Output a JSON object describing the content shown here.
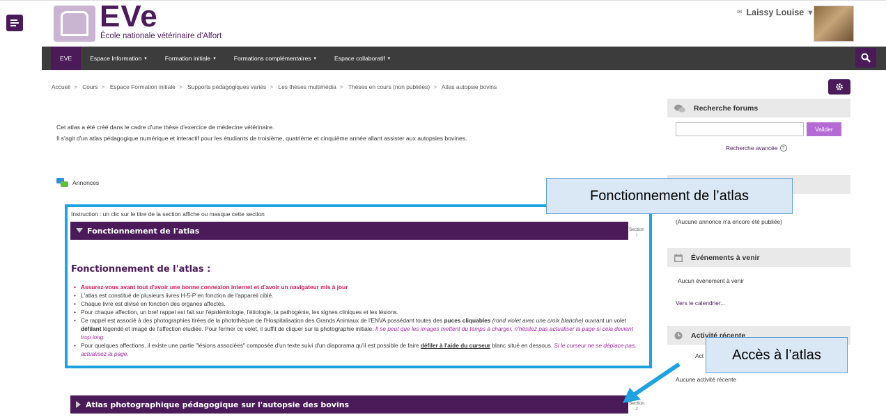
{
  "header": {
    "logo_text": "EVe",
    "logo_subtitle": "École nationale vétérinaire d'Alfort",
    "user_name": "Laissy Louise",
    "user_caret": "▾"
  },
  "navbar": {
    "items": [
      {
        "label": "EVE",
        "caret": ""
      },
      {
        "label": "Espace Information",
        "caret": "▾"
      },
      {
        "label": "Formation initiale",
        "caret": "▾"
      },
      {
        "label": "Formations complémentaires",
        "caret": "▾"
      },
      {
        "label": "Espace collaboratif",
        "caret": "▾"
      }
    ]
  },
  "breadcrumb": {
    "items": [
      "Accueil",
      "Cours",
      "Espace Formation initiale",
      "Supports pédagogiques variés",
      "Les thèses multimédia",
      "Thèses en cours (non publiées)",
      "Atlas autopsie bovins"
    ],
    "separator": ">"
  },
  "intro": {
    "line1": "Cet atlas a été créé dans le cadre d'une thèse d'exercice de médecine vétérinaire.",
    "line2": "Il s'agit d'un atlas pédagogique numérique et interactif pour les étudiants de troisième, quatrième et cinquième année allant assister aux autopsies bovines."
  },
  "annonces_label": "Annonces",
  "instruction": "Instruction : un clic sur le titre de la section affiche ou masque cette section",
  "section1": {
    "title": "Fonctionnement de l'atlas",
    "label": "Section",
    "number": "1",
    "heading": "Fonctionnement de l'atlas :",
    "bullets": {
      "b1": "Assurez-vous avant tout d'avoir une bonne connexion internet et d'avoir un navigateur mis à jour",
      "b2": "L'atlas est constitué de plusieurs livres H-5-P en fonction de l'appareil ciblé.",
      "b3": "Chaque livre est divisé en fonction des organes affectés.",
      "b4": "Pour chaque affection, un bref rappel est fait sur l'épidémiologie, l'étiologie, la pathogénie, les signes cliniques et les lésions.",
      "b5_a": "Ce rappel est associé à des photographies tirées de la photothèque de l'Hospitalisation des Grands Animaux de l'ENVA possédant toutes des ",
      "b5_b": "puces cliquables",
      "b5_c": " (rond violet avec une croix blanche)",
      "b5_d": " ouvrant un volet ",
      "b5_e": "défilant",
      "b5_f": " légendé et imagé de l'affection étudiée. Pour fermer ce volet, il suffit de cliquer sur la photographie initiale. ",
      "b5_g": "Il se peut que les images mettent du temps à charger, n'hésitez pas actualiser la page si cela devient trop long.",
      "b6_a": "Pour quelques affections, il existe une partie \"lésions associées\" composée d'un texte suivi d'un diaporama qu'il est possible de faire ",
      "b6_b": "défiler à l'aide du curseur",
      "b6_c": " blanc situé en dessous. ",
      "b6_d": "Si le curseur ne se déplace pas, actualisez la page."
    }
  },
  "section2": {
    "title": "Atlas photographique pédagogique sur l'autopsie des bovins",
    "label": "Section",
    "number": "2"
  },
  "sidebar": {
    "forum_title": "Recherche forums",
    "search_button": "Valider",
    "advanced_search": "Recherche avancée",
    "no_announcement": "(Aucune annonce n'a encore été publiée)",
    "events_title": "Événements à venir",
    "no_events": "Aucun événement à venir",
    "calendar_link": "Vers le calendrier...",
    "activity_title": "Activité récente",
    "activity_partial": "Act",
    "no_activity": "Aucune activité récente"
  },
  "callouts": {
    "fonctionnement": "Fonctionnement de l’atlas",
    "acces": "Accès à l’atlas"
  },
  "colors": {
    "brand_purple": "#4a1a59",
    "navbar": "#3c3c3c",
    "highlight_blue": "#1fa2e0",
    "button_violet": "#b46bd3"
  }
}
